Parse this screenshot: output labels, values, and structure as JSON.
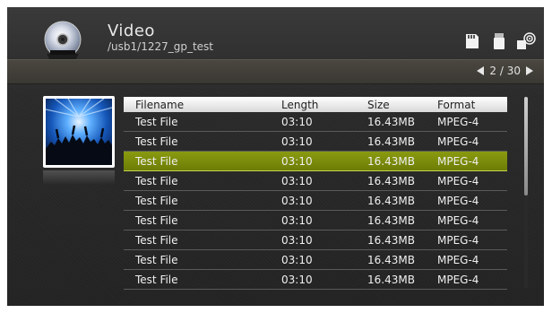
{
  "header": {
    "title": "Video",
    "path": "/usb1/1227_gp_test",
    "icons": [
      "sd-card-icon",
      "usb-drive-icon",
      "network-share-icon"
    ]
  },
  "pager": {
    "text": "2 / 30"
  },
  "table": {
    "columns": [
      "Filename",
      "Length",
      "Size",
      "Format"
    ],
    "rows": [
      {
        "name": "Test File",
        "length": "03:10",
        "size": "16.43MB",
        "format": "MPEG-4"
      },
      {
        "name": "Test File",
        "length": "03:10",
        "size": "16.43MB",
        "format": "MPEG-4"
      },
      {
        "name": "Test File",
        "length": "03:10",
        "size": "16.43MB",
        "format": "MPEG-4"
      },
      {
        "name": "Test File",
        "length": "03:10",
        "size": "16.43MB",
        "format": "MPEG-4"
      },
      {
        "name": "Test File",
        "length": "03:10",
        "size": "16.43MB",
        "format": "MPEG-4"
      },
      {
        "name": "Test File",
        "length": "03:10",
        "size": "16.43MB",
        "format": "MPEG-4"
      },
      {
        "name": "Test File",
        "length": "03:10",
        "size": "16.43MB",
        "format": "MPEG-4"
      },
      {
        "name": "Test File",
        "length": "03:10",
        "size": "16.43MB",
        "format": "MPEG-4"
      },
      {
        "name": "Test File",
        "length": "03:10",
        "size": "16.43MB",
        "format": "MPEG-4"
      }
    ],
    "selected_index": 2
  },
  "colors": {
    "selection": "#7b8b0a",
    "background": "#2a2a2a"
  }
}
